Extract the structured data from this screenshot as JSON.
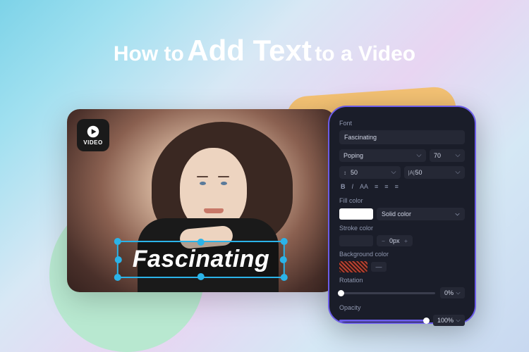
{
  "title": {
    "pre": "How to",
    "main": "Add Text",
    "post": "to a Video"
  },
  "video": {
    "badge": "VIDEO",
    "overlay_text": "Fascinating"
  },
  "panel": {
    "font_section": "Font",
    "font_value": "Fascinating",
    "font_family": "Poping",
    "font_size": "70",
    "line_height": "50",
    "letter_spacing": "50",
    "line_label": "↕",
    "letter_label": "|A|",
    "format": {
      "bold": "B",
      "italic": "I",
      "case": "AA",
      "a1": "≡",
      "a2": "≡",
      "a3": "≡"
    },
    "fill_label": "Fill color",
    "fill_mode": "Solid color",
    "stroke_label": "Stroke color",
    "stroke_size": "0px",
    "bg_label": "Background color",
    "rotation_label": "Rotation",
    "rotation_value": "0%",
    "opacity_label": "Opacity",
    "opacity_value": "100%"
  },
  "colors": {
    "accent": "#6b5ce8",
    "handle": "#2bb3e8"
  }
}
